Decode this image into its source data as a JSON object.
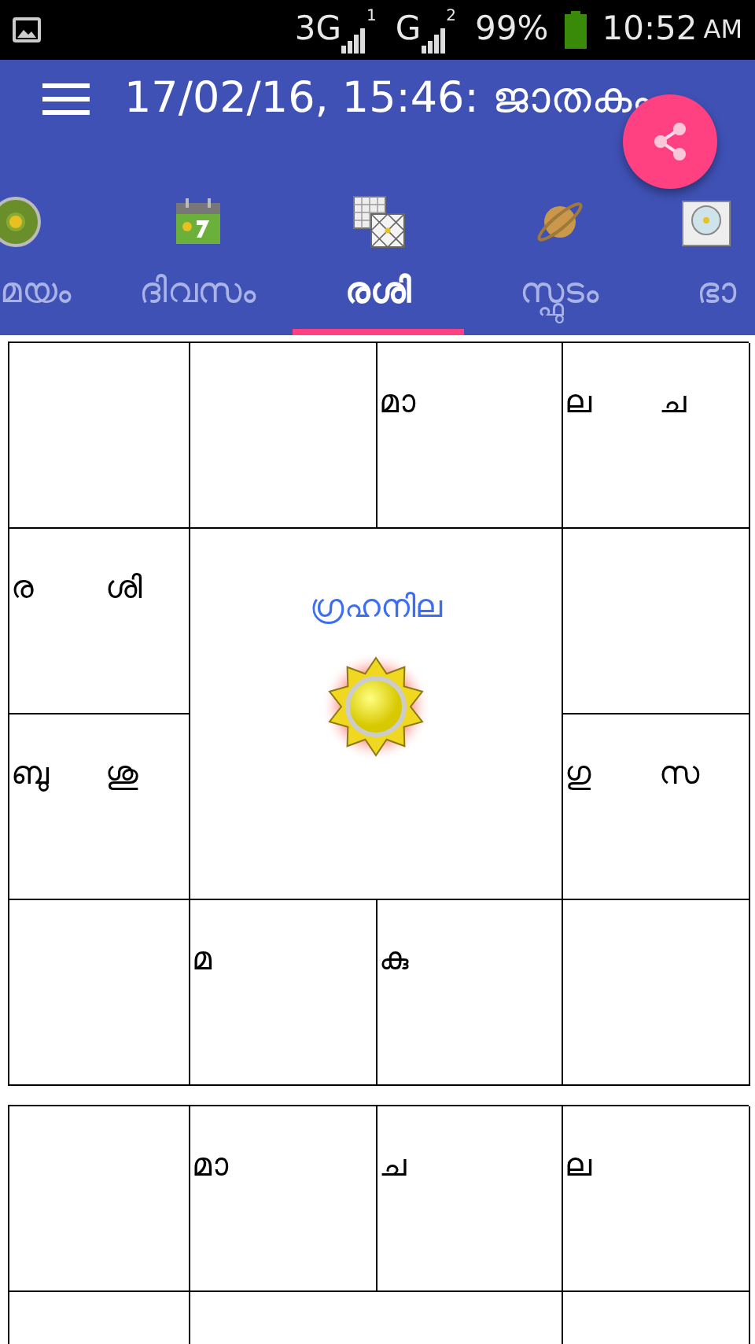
{
  "status_bar": {
    "network_1": "3G",
    "network_2": "G",
    "sim_1": "1",
    "sim_2": "2",
    "battery": "99%",
    "time": "10:52",
    "ampm": "AM"
  },
  "app_bar": {
    "title": "17/02/16, 15:46: ജാതകം"
  },
  "tabs": [
    {
      "label": "മയം",
      "kind": "clock",
      "selected": false
    },
    {
      "label": "ദിവസം",
      "kind": "calendar",
      "selected": false
    },
    {
      "label": "രശി",
      "kind": "chart",
      "selected": true
    },
    {
      "label": "സ്ഫുടം",
      "kind": "planet",
      "selected": false
    },
    {
      "label": "ഭാ",
      "kind": "wheel",
      "selected": false
    }
  ],
  "charts": [
    {
      "rows": [
        [
          {},
          {},
          {
            "planets": [
              "മാ"
            ]
          },
          {
            "planets": [
              "ല",
              "ച"
            ]
          }
        ],
        [
          {
            "planets": [
              "ര",
              "ശി"
            ]
          },
          {
            "kind": "center",
            "title": "ഗ്രഹനില",
            "colspan": 2,
            "rowspan": 2
          },
          {}
        ],
        [
          {
            "planets": [
              "ബു",
              "ശു"
            ]
          },
          {
            "planets": [
              "ഗു",
              "സ"
            ]
          }
        ],
        [
          {},
          {
            "planets": [
              "മ"
            ]
          },
          {
            "planets": [
              "കു"
            ]
          },
          {}
        ]
      ]
    },
    {
      "rows": [
        [
          {},
          {
            "planets": [
              "മാ"
            ]
          },
          {
            "planets": [
              "ച"
            ]
          },
          {
            "planets": [
              "ല"
            ]
          }
        ],
        [
          {},
          {
            "kind": "center",
            "colspan": 2,
            "rowspan": 2
          },
          {}
        ]
      ]
    }
  ]
}
